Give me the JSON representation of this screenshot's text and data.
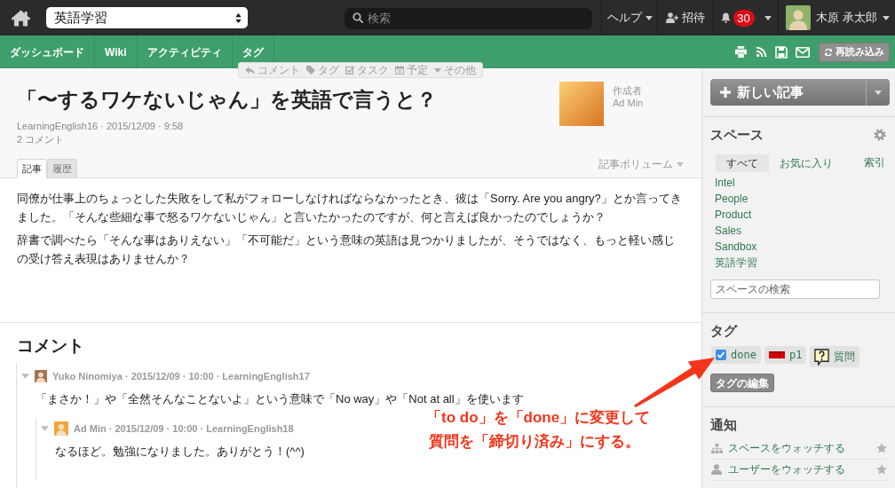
{
  "top_bar": {
    "space_select": {
      "value": "英語学習"
    },
    "search": {
      "placeholder": "検索"
    },
    "help": {
      "label": "ヘルプ"
    },
    "invite": {
      "label": "招待"
    },
    "notifications": {
      "count": "30"
    },
    "user": {
      "name": "木原 承太郎"
    }
  },
  "nav_bar": {
    "tabs": [
      {
        "label": "ダッシュボード",
        "selected": false
      },
      {
        "label": "Wiki",
        "selected": false
      },
      {
        "label": "アクティビティ",
        "selected": false
      },
      {
        "label": "タグ",
        "selected": false
      }
    ],
    "reload_button": {
      "label": "再読み込み"
    }
  },
  "quick_actions": [
    {
      "kind": "comment",
      "label": "コメント"
    },
    {
      "kind": "tag",
      "label": "タグ"
    },
    {
      "kind": "task",
      "label": "タスク"
    },
    {
      "kind": "event",
      "label": "予定"
    },
    {
      "kind": "more",
      "label": "その他"
    }
  ],
  "article": {
    "title": "「〜するワケないじゃん」を英語で言うと？",
    "author": {
      "label": "作成者",
      "name": "Ad Min"
    },
    "meta": "LearningEnglish16 · 2015/12/09 · 9:58",
    "comment_count": "2 コメント",
    "tabs": [
      {
        "label": "記事",
        "selected": true
      },
      {
        "label": "履歴",
        "selected": false
      }
    ],
    "volume_menu": {
      "label": "記事ボリューム"
    },
    "paragraphs": [
      "同僚が仕事上のちょっとした失敗をして私がフォローしなければならなかったとき、彼は「Sorry. Are you angry?」とか言ってきました。「そんな些細な事で怒るワケないじゃん」と言いたかったのですが、何と言えば良かったのでしょうか？",
      "辞書で調べたら「そんな事はありえない」「不可能だ」という意味の英語は見つかりましたが、そうではなく、もっと軽い感じの受け答え表現はありませんか？"
    ]
  },
  "comments": {
    "heading": "コメント",
    "items": [
      {
        "meta": "Yuko Ninomiya · 2015/12/09 · 10:00 · LearningEnglish17",
        "text": "「まさか！」や「全然そんなことないよ」という意味で「No way」や「Not at all」を使います",
        "expanded": true,
        "children": [
          {
            "meta": "Ad Min · 2015/12/09 · 10:00 · LearningEnglish18",
            "text": "なるほど。勉強になりました。ありがとう！(^^)",
            "expanded": true
          }
        ]
      }
    ]
  },
  "annotation": {
    "lines": [
      "「to do」を「done」に変更して",
      "質問を「締切り済み」にする。"
    ]
  },
  "sidebar": {
    "new_article_button": {
      "label": "新しい記事"
    },
    "spaces": {
      "heading": "スペース",
      "tabs": [
        {
          "label": "すべて",
          "selected": true
        },
        {
          "label": "お気に入り",
          "selected": false
        }
      ],
      "index_link": "索引",
      "items": [
        "Intel",
        "People",
        "Product",
        "Sales",
        "Sandbox",
        "英語学習"
      ],
      "search": {
        "placeholder": "スペースの検索"
      }
    },
    "tags": {
      "heading": "タグ",
      "items": [
        {
          "kind": "check",
          "label": "done"
        },
        {
          "kind": "priority",
          "label": "p1"
        },
        {
          "kind": "question",
          "label": "質問"
        }
      ],
      "edit_button": {
        "label": "タグの編集"
      }
    },
    "notifications": {
      "heading": "通知",
      "items": [
        {
          "kind": "space",
          "label": "スペースをウォッチする",
          "starred": false
        },
        {
          "kind": "user",
          "label": "ユーザーをウォッチする",
          "starred": false
        }
      ]
    }
  }
}
